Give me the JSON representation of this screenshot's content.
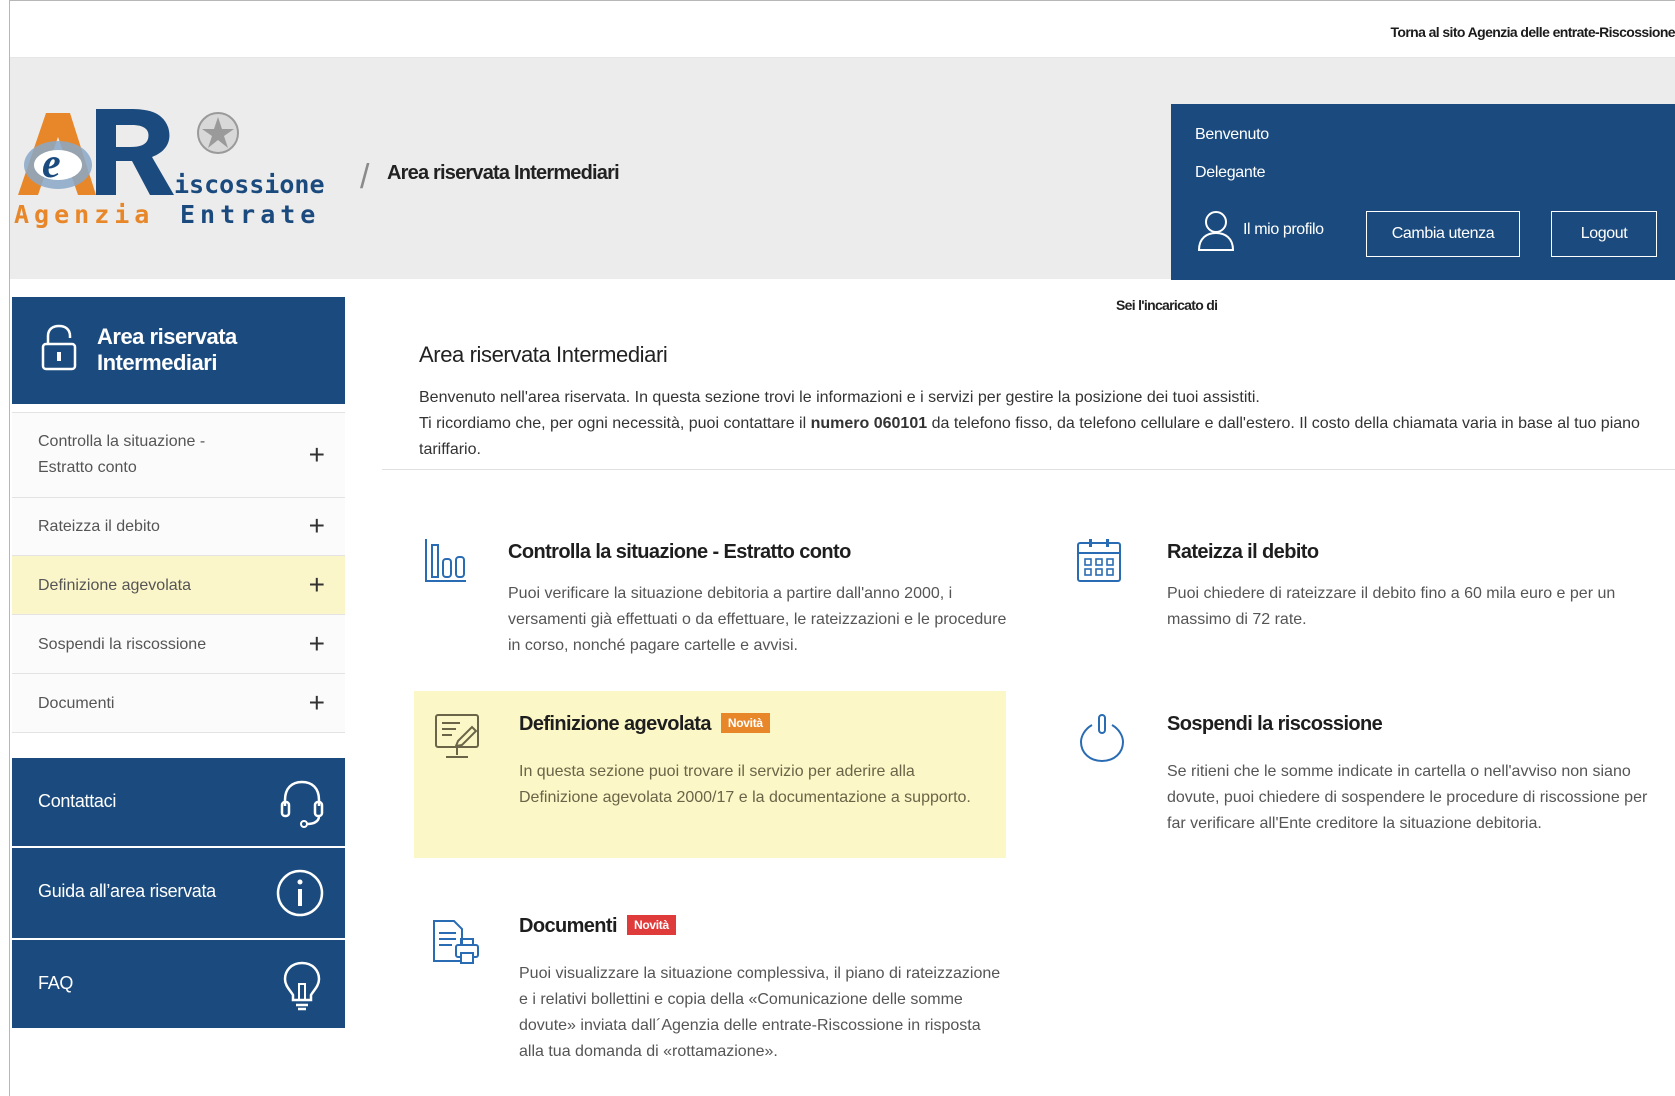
{
  "topbar": {
    "back_link": "Torna al sito Agenzia delle entrate-Riscossione"
  },
  "header": {
    "logo_text_top": "iscossione",
    "logo_text_bottom": "Agenzia Entrate",
    "breadcrumb_separator": "/",
    "breadcrumb_title": "Area riservata Intermediari"
  },
  "user": {
    "welcome": "Benvenuto",
    "role": "Delegante",
    "profile_label": "Il mio profilo",
    "change_user_label": "Cambia utenza",
    "logout_label": "Logout"
  },
  "sidebar": {
    "title": "Area riservata Intermediari",
    "items": [
      {
        "label": "Controlla la situazione - Estratto conto"
      },
      {
        "label": "Rateizza il debito"
      },
      {
        "label": "Definizione agevolata"
      },
      {
        "label": "Sospendi la riscossione"
      },
      {
        "label": "Documenti"
      }
    ],
    "expand_symbol": "+",
    "contact_label": "Contattaci",
    "guide_label": "Guida all’area riservata",
    "faq_label": "FAQ"
  },
  "main": {
    "delegate_note": "Sei l'incaricato di",
    "title": "Area riservata Intermediari",
    "intro_line1": "Benvenuto nell'area riservata. In questa sezione trovi le informazioni e i servizi per gestire la posizione dei tuoi assistiti.",
    "intro_line2_pre": "Ti ricordiamo che, per ogni necessità, puoi contattare il ",
    "intro_line2_bold": "numero 060101",
    "intro_line2_post": " da telefono fisso, da telefono cellulare e dall'estero. Il costo della chiamata varia in base al tuo piano tariffario.",
    "badge_new": "Novità",
    "cards": [
      {
        "title": "Controlla la situazione - Estratto conto",
        "text": "Puoi verificare la situazione debitoria a partire dall'anno 2000, i versamenti già effettuati o da effettuare, le rateizzazioni e le procedure in corso, nonché pagare cartelle e avvisi."
      },
      {
        "title": "Rateizza il debito",
        "text": "Puoi chiedere di rateizzare il debito fino a 60 mila euro e per un massimo di 72 rate."
      },
      {
        "title": "Definizione agevolata",
        "text": "In questa sezione puoi trovare il servizio per aderire alla Definizione agevolata 2000/17 e la documentazione a supporto."
      },
      {
        "title": "Sospendi la riscossione",
        "text": "Se ritieni che le somme indicate in cartella o nell'avviso non siano dovute, puoi chiedere di sospendere le procedure di riscossione per far verificare all'Ente creditore la situazione debitoria."
      },
      {
        "title": "Documenti",
        "text": "Puoi visualizzare la situazione complessiva, il piano di rateizzazione e i relativi bollettini e copia della «Comunicazione delle somme dovute» inviata dall´Agenzia delle entrate-Riscossione in risposta alla tua domanda di «rottamazione»."
      }
    ]
  },
  "colors": {
    "brand_blue": "#1b4b7e",
    "highlight": "#fbf7c6",
    "badge_orange": "#e8872a",
    "badge_red": "#e03b3b",
    "icon_blue": "#2a6cb3"
  },
  "icons": [
    "user-icon",
    "lock-icon",
    "headset-icon",
    "info-icon",
    "lightbulb-icon",
    "chart-icon",
    "calendar-icon",
    "edit-screen-icon",
    "power-icon",
    "documents-icon"
  ]
}
